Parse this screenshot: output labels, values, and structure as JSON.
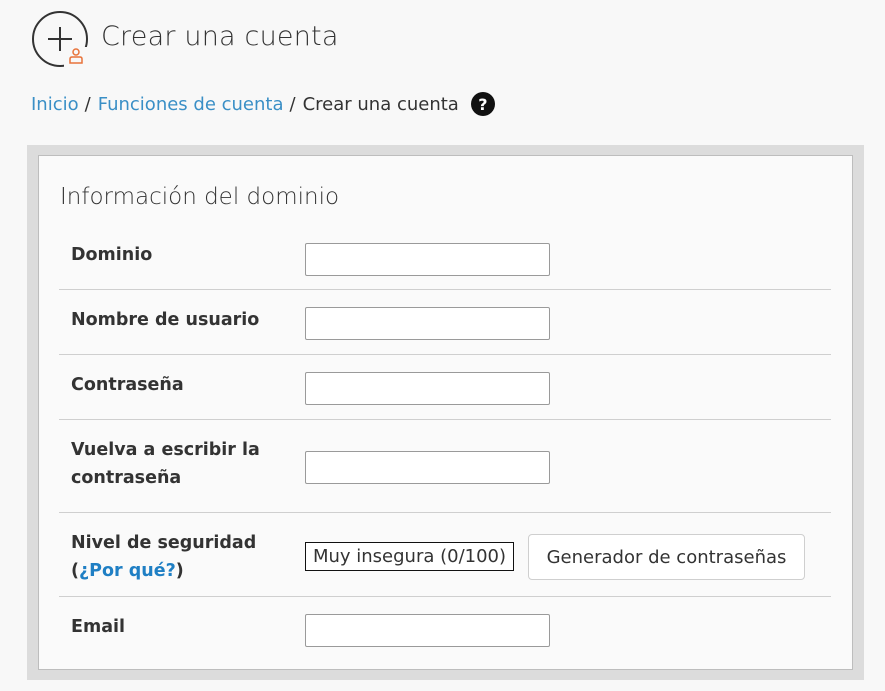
{
  "header": {
    "title": "Crear una cuenta",
    "icon": "add-account-icon",
    "accent_color": "#e8733a"
  },
  "breadcrumb": {
    "items": [
      {
        "label": "Inicio",
        "link": true
      },
      {
        "label": "Funciones de cuenta",
        "link": true
      },
      {
        "label": "Crear una cuenta",
        "link": false
      }
    ],
    "separator": "/",
    "help_icon": "?"
  },
  "form": {
    "section_title": "Información del dominio",
    "fields": {
      "domain": {
        "label": "Dominio",
        "value": ""
      },
      "username": {
        "label": "Nombre de usuario",
        "value": ""
      },
      "password": {
        "label": "Contraseña",
        "value": ""
      },
      "password_confirm": {
        "label_line1": "Vuelva a escribir la",
        "label_line2": "contraseña",
        "value": ""
      },
      "strength": {
        "label": "Nivel de seguridad",
        "why_open": "(",
        "why_link": "¿Por qué?",
        "why_close": ")",
        "meter_text": "Muy insegura (0/100)",
        "score": 0,
        "generator_button": "Generador de contraseñas"
      },
      "email": {
        "label": "Email",
        "value": ""
      }
    }
  }
}
